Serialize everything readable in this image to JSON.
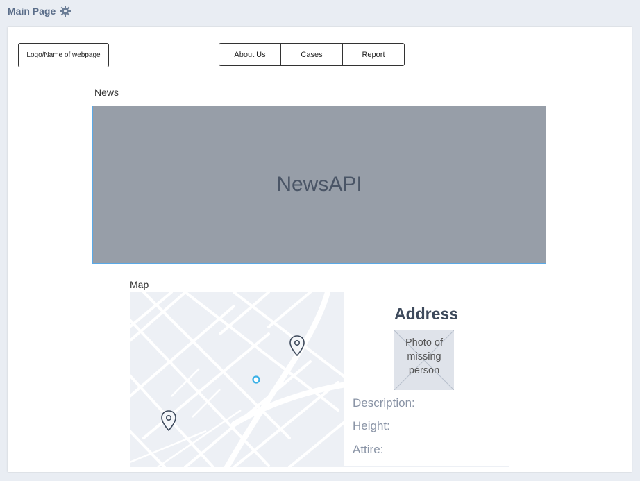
{
  "header": {
    "title": "Main Page",
    "settings_icon": "gear-icon"
  },
  "toolbar": {
    "logo_label": "Logo/Name of webpage",
    "nav": [
      {
        "label": "About Us"
      },
      {
        "label": "Cases"
      },
      {
        "label": "Report"
      }
    ]
  },
  "news": {
    "label": "News",
    "placeholder_text": "NewsAPI"
  },
  "map": {
    "label": "Map",
    "markers": [
      "map-pin-icon",
      "map-pin-icon",
      "current-location-icon"
    ],
    "card": {
      "title": "Address",
      "photo_text": "Photo of missing person",
      "fields": [
        "Description:",
        "Height:",
        "Attire:"
      ]
    }
  },
  "colors": {
    "page_bg": "#e9edf3",
    "news_bg": "#979ea8",
    "news_border": "#5aa9e6",
    "map_bg": "#edf0f5",
    "location_dot": "#3ab0e6"
  }
}
